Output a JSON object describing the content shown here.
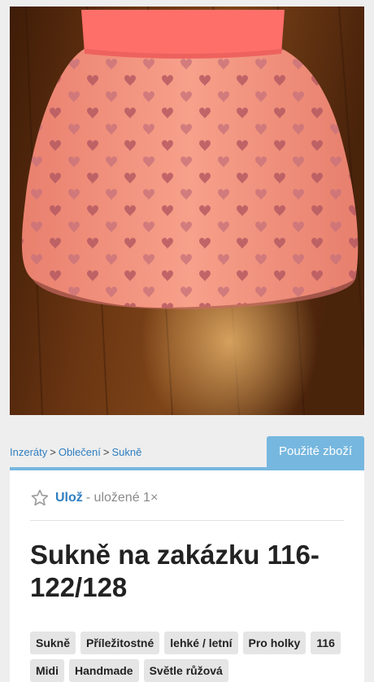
{
  "photo": {
    "alt": "Sukně na zakázku"
  },
  "breadcrumb": {
    "items": [
      "Inzeráty",
      "Oblečení",
      "Sukně"
    ],
    "separator": ">"
  },
  "badge": {
    "label": "Použité zboží",
    "color": "#76b7df"
  },
  "save": {
    "label": "Ulož",
    "count_text": "- uložené 1×",
    "icon": "star-outline-icon"
  },
  "listing": {
    "title": "Sukně na zakázku 116-122/128",
    "tags": [
      "Sukně",
      "Příležitostné",
      "lehké / letní",
      "Pro holky",
      "116",
      "Midi",
      "Handmade",
      "Světle růžová"
    ]
  },
  "colors": {
    "link": "#2f7ec0",
    "skirt": "#f3907c",
    "waistband": "#ff6f6a",
    "wood": "#5a2d0f"
  }
}
